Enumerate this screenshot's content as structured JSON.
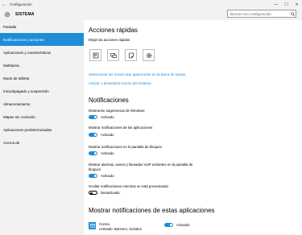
{
  "window": {
    "title": "Configuración",
    "back_icon": "back-arrow-icon",
    "minimize": "—",
    "maximize": "☐",
    "close": "✕"
  },
  "header": {
    "section": "SISTEMA",
    "icon": "gear-icon",
    "search_placeholder": "Buscar una configuración"
  },
  "sidebar": {
    "items": [
      {
        "label": "Pantalla"
      },
      {
        "label": "Notificaciones y acciones",
        "active": true
      },
      {
        "label": "Aplicaciones y características"
      },
      {
        "label": "Multitarea"
      },
      {
        "label": "Modo de tableta"
      },
      {
        "label": "Inicio/apagado y suspensión"
      },
      {
        "label": "Almacenamiento"
      },
      {
        "label": "Mapas sin conexión"
      },
      {
        "label": "Aplicaciones predeterminadas"
      },
      {
        "label": "Acerca de"
      }
    ]
  },
  "quick_actions": {
    "heading": "Acciones rápidas",
    "subtitle": "Elegir las acciones rápidas",
    "tiles": [
      "tablet-mode-icon",
      "connect-icon",
      "note-icon",
      "settings-icon"
    ],
    "link_taskbar": "Seleccionar los iconos que aparecerán en la barra de tareas",
    "link_system_icons": "Activar o desactivar iconos del sistema"
  },
  "notifications": {
    "heading": "Notificaciones",
    "settings": [
      {
        "label": "Mostrarme sugerencias de Windows",
        "state": "Activado",
        "on": true
      },
      {
        "label": "Mostrar notificaciones de las aplicaciones",
        "state": "Activado",
        "on": true
      },
      {
        "label": "Mostrar notificaciones en la pantalla de bloqueo",
        "state": "Activado",
        "on": true
      },
      {
        "label_line1": "Mostrar alarmas, avisos y llamadas VoIP entrantes en la pantalla de",
        "label_line2": "bloqueo",
        "state": "Activado",
        "on": true
      },
      {
        "label": "Ocultar notificaciones mientras se está presentando",
        "state": "Desactivado",
        "on": false
      }
    ]
  },
  "app_notifications": {
    "heading": "Mostrar notificaciones de estas aplicaciones",
    "apps": [
      {
        "name": "Correo",
        "detail": "Activado: Banners, Sonidos",
        "state": "Activado",
        "on": true,
        "icon": "mail-icon"
      }
    ]
  },
  "colors": {
    "accent": "#1f8dd6",
    "sidebar_bg": "#f2f2f2"
  }
}
